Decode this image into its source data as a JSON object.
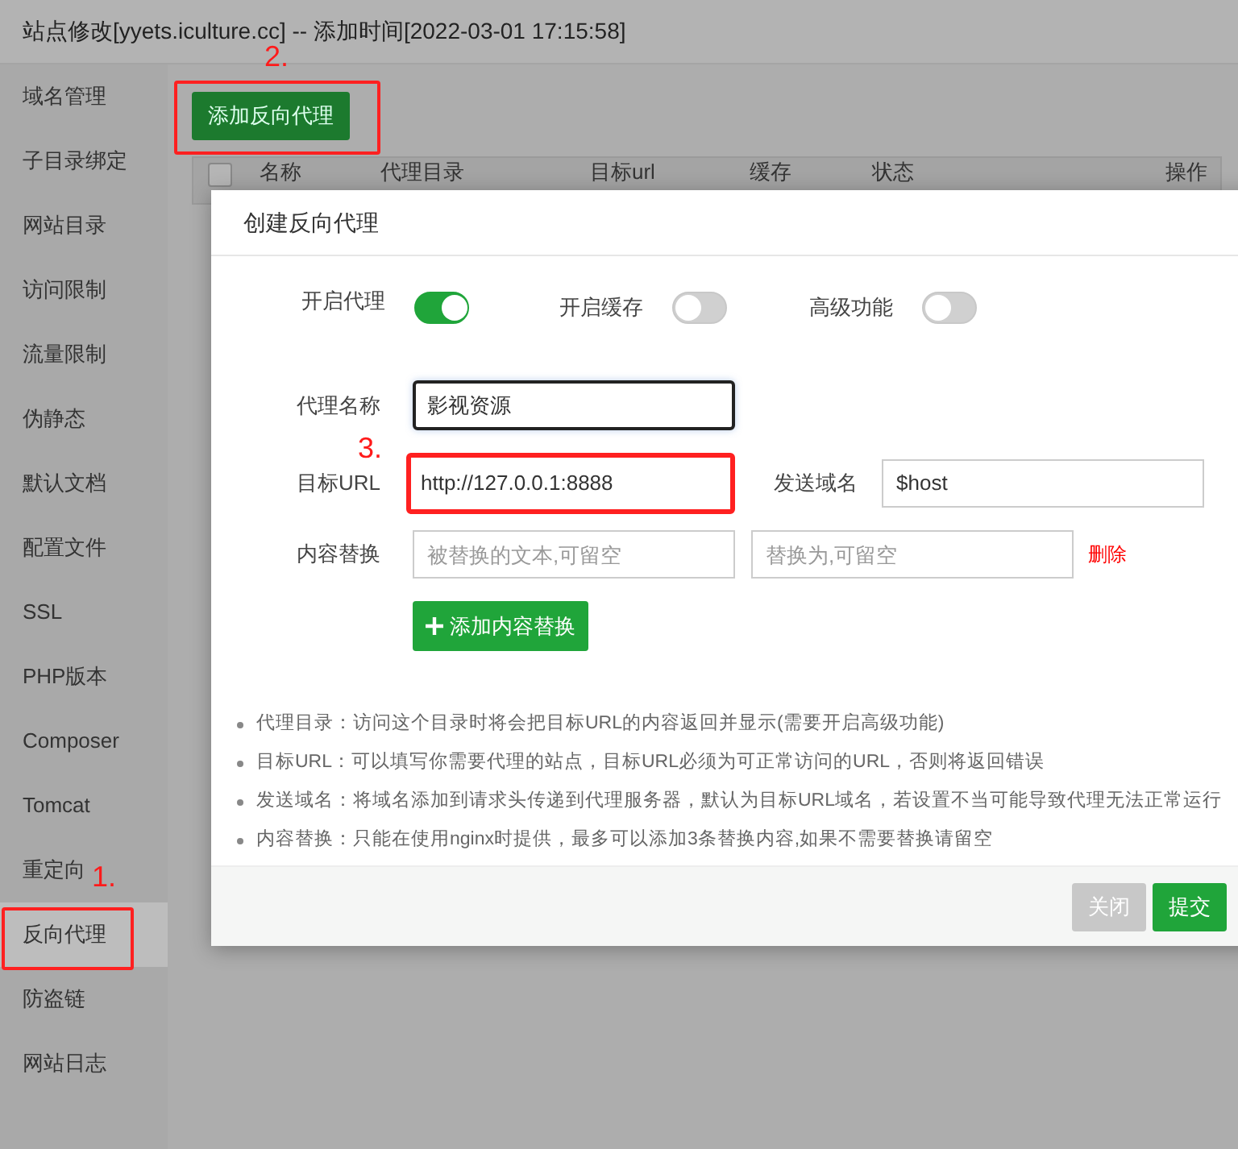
{
  "window": {
    "title": "站点修改[yyets.iculture.cc] -- 添加时间[2022-03-01 17:15:58]"
  },
  "sidebar": {
    "items": [
      {
        "label": "域名管理",
        "selected": false
      },
      {
        "label": "子目录绑定",
        "selected": false
      },
      {
        "label": "网站目录",
        "selected": false
      },
      {
        "label": "访问限制",
        "selected": false
      },
      {
        "label": "流量限制",
        "selected": false
      },
      {
        "label": "伪静态",
        "selected": false
      },
      {
        "label": "默认文档",
        "selected": false
      },
      {
        "label": "配置文件",
        "selected": false
      },
      {
        "label": "SSL",
        "selected": false
      },
      {
        "label": "PHP版本",
        "selected": false
      },
      {
        "label": "Composer",
        "selected": false
      },
      {
        "label": "Tomcat",
        "selected": false
      },
      {
        "label": "重定向",
        "selected": false
      },
      {
        "label": "反向代理",
        "selected": true
      },
      {
        "label": "防盗链",
        "selected": false
      },
      {
        "label": "网站日志",
        "selected": false
      }
    ]
  },
  "toolbar": {
    "add_button": "添加反向代理"
  },
  "table": {
    "select_all_checked": false,
    "columns": [
      "名称",
      "代理目录",
      "目标url",
      "缓存",
      "状态",
      "操作"
    ]
  },
  "dialog": {
    "title": "创建反向代理",
    "toggles": [
      {
        "label": "开启代理",
        "on": true
      },
      {
        "label": "开启缓存",
        "on": false
      },
      {
        "label": "高级功能",
        "on": false
      }
    ],
    "proxy_name": {
      "label": "代理名称",
      "value": "影视资源"
    },
    "target_url": {
      "label": "目标URL",
      "value": "http://127.0.0.1:8888"
    },
    "send_domain": {
      "label": "发送域名",
      "value": "$host"
    },
    "content_replace": {
      "label": "内容替换",
      "placeholders": [
        "被替换的文本,可留空",
        "替换为,可留空"
      ],
      "delete_link": "删除"
    },
    "add_replace_button": "添加内容替换",
    "notes": [
      "代理目录：访问这个目录时将会把目标URL的内容返回并显示(需要开启高级功能)",
      "目标URL：可以填写你需要代理的站点，目标URL必须为可正常访问的URL，否则将返回错误",
      "发送域名：将域名添加到请求头传递到代理服务器，默认为目标URL域名，若设置不当可能导致代理无法正常运行",
      "内容替换：只能在使用nginx时提供，最多可以添加3条替换内容,如果不需要替换请留空"
    ],
    "buttons": [
      {
        "label": "关闭",
        "kind": "secondary"
      },
      {
        "label": "提交",
        "kind": "primary"
      }
    ]
  },
  "annotations": {
    "sidebar_marker": "1.",
    "button_marker": "2.",
    "url_marker": "3."
  }
}
